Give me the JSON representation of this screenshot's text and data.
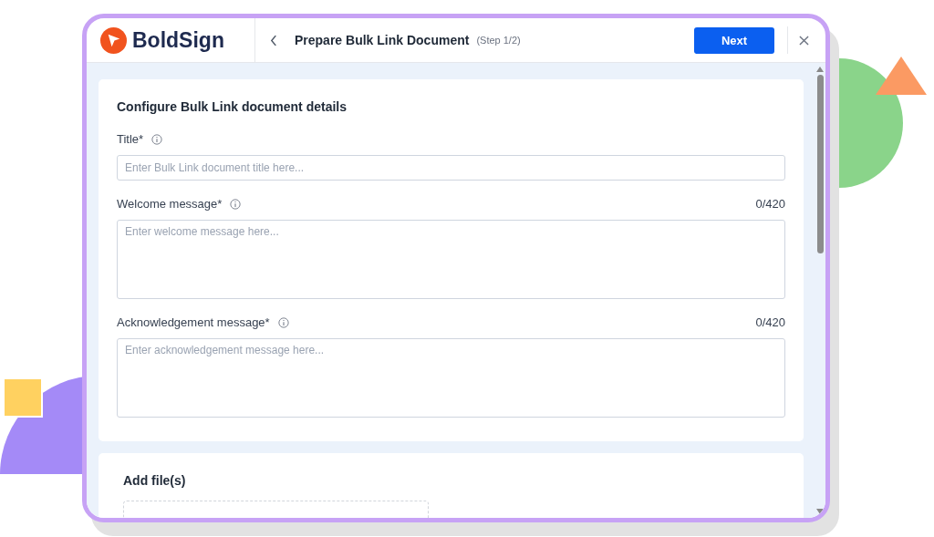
{
  "header": {
    "logo": "BoldSign",
    "title": "Prepare Bulk Link Document",
    "step": "(Step 1/2)",
    "next_button": "Next"
  },
  "details_card": {
    "heading": "Configure Bulk Link document details",
    "fields": [
      {
        "kind": "input",
        "label": "Title*",
        "placeholder": "Enter Bulk Link document title here..."
      },
      {
        "kind": "textarea",
        "label": "Welcome message*",
        "counter": "0/420",
        "placeholder": "Enter welcome message here..."
      },
      {
        "kind": "textarea",
        "label": "Acknowledgement message*",
        "counter": "0/420",
        "placeholder": "Enter acknowledgement message here..."
      }
    ]
  },
  "files_card": {
    "heading": "Add file(s)"
  }
}
